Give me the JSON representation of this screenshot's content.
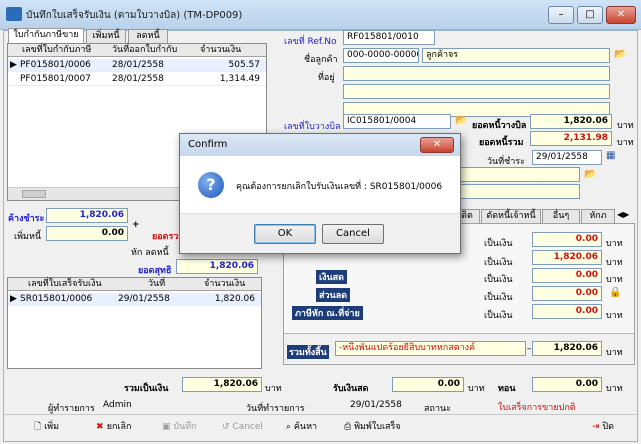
{
  "window": {
    "title": "บันทึกใบเสร็จรับเงิน (ตามใบวางบิล) (TM-DP009)",
    "minimize": "–",
    "maximize": "□",
    "close": "✕"
  },
  "tabs": [
    "ใบกำกับภาษีขาย",
    "เพิ่มหนี้",
    "ลดหนี้"
  ],
  "invoice_grid": {
    "headers": [
      "เลขที่ใบกำกับภาษี",
      "วันที่ออกใบกำกับ",
      "จำนวนเงิน"
    ],
    "rows": [
      {
        "no": "PF015801/0006",
        "date": "28/01/2558",
        "amount": "505.57"
      },
      {
        "no": "PF015801/0007",
        "date": "28/01/2558",
        "amount": "1,314.49"
      }
    ]
  },
  "left_summary": {
    "outstanding_label": "ค้างชำระ",
    "outstanding": "1,820.06",
    "add_debt_label": "เพิ่มหนี้",
    "add_debt": "0.00",
    "total_label": "ยอดรวม",
    "deduct_label": "หัก  ลดหนี้",
    "net_label": "ยอดสุทธิ",
    "net": "1,820.06"
  },
  "receipt_grid": {
    "headers": [
      "เลขที่ใบเสร็จรับเงิน",
      "วันที่",
      "จำนวนเงิน"
    ],
    "rows": [
      {
        "no": "SR015801/0006",
        "date": "29/01/2558",
        "amount": "1,820.06"
      }
    ]
  },
  "header_form": {
    "ref_label": "เลขที่ Ref.No",
    "ref": "RF015801/0010",
    "customer_label": "ชื่อลูกค้า",
    "customer_code": "000-0000-00000",
    "customer_name": "ลูกค้าจร",
    "address_label": "ที่อยู่",
    "bill_label": "เลขที่ใบวางบิล",
    "bill_no": "IC015801/0004",
    "bill_total_label": "ยอดหนี้วางบิล",
    "bill_total": "1,820.06",
    "total_debt_label": "ยอดหนี้รวม",
    "total_debt": "2,131.98",
    "baht": "บาท",
    "pay_date_label": "วันที่ชำระ",
    "pay_date": "29/01/2558"
  },
  "pay_tabs": [
    "ตัดหนี้เจ้าหนี้",
    "อื่นๆ",
    "หักภ"
  ],
  "pay_tab_partial": "ดิต",
  "payment": {
    "rows": [
      {
        "label": "",
        "value": "0.00"
      },
      {
        "label": "",
        "value": "1,820.06"
      },
      {
        "label": "เงินสด",
        "value": "0.00"
      },
      {
        "label": "ส่วนลด",
        "value": "0.00"
      },
      {
        "label": "ภาษีหัก ณ.ที่จ่าย",
        "value": "0.00"
      }
    ],
    "as_money": "เป็นเงิน",
    "total_label": "รวมทั้งสิ้น",
    "total_words": "-หนึ่งพันแปดร้อยยี่สิบบาทหกสตางค์",
    "total": "1,820.06"
  },
  "footer": {
    "sum_label": "รวมเป็นเงิน",
    "sum": "1,820.06",
    "baht": "บาท",
    "receive_label": "รับเงินสด",
    "receive": "0.00",
    "change_label": "ทอน",
    "change": "0.00",
    "operator_label": "ผู้ทำรายการ",
    "operator": "Admin",
    "trans_date_label": "วันที่ทำรายการ",
    "trans_date": "29/01/2558",
    "status_label": "สถานะ",
    "status": "ใบเสร็จการขายปกติ"
  },
  "toolbar": {
    "add": "เพิ่ม",
    "cancel_doc": "ยกเลิก",
    "save": "บันทึก",
    "cancel": "Cancel",
    "search": "ค้นหา",
    "print": "พิมพ์ใบเสร็จ",
    "close": "ปิด"
  },
  "dialog": {
    "title": "Confirm",
    "message": "คุณต้องการยกเลิกใบรับเงินเลขที่ : SR015801/0006",
    "ok": "OK",
    "cancel": "Cancel",
    "icon": "?"
  },
  "colors": {
    "accent_blue": "#1f1fd0",
    "alert_red": "#d01010",
    "navy_header": "#1d3d7a",
    "highlight_yellow": "#ffffe1"
  }
}
